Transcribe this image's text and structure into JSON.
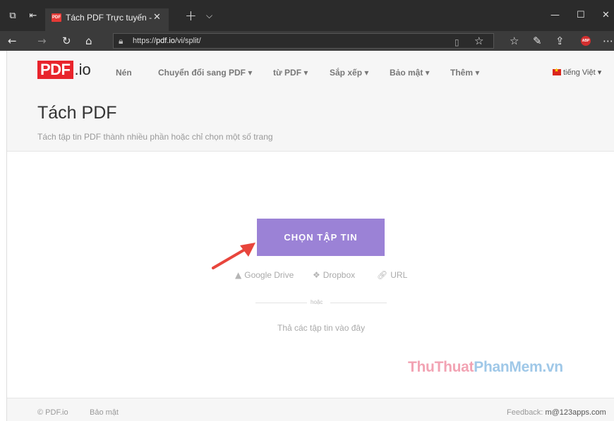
{
  "browser": {
    "tab_title": "Tách PDF Trực tuyến - Tr",
    "favicon_text": "PDF",
    "url_prefix": "https://",
    "url_host": "pdf.io",
    "url_path": "/vi/split/",
    "icons": {
      "tab_actions": "tab-actions-icon",
      "tab_back": "set-aside-tabs-icon",
      "close": "close-icon",
      "new_tab": "plus-icon",
      "tab_list": "chevron-down-icon",
      "minimize": "minimize-icon",
      "maximize": "maximize-icon",
      "window_close": "close-icon",
      "back": "back-arrow-icon",
      "forward": "forward-arrow-icon",
      "refresh": "refresh-icon",
      "home": "home-icon",
      "lock": "lock-icon",
      "reading": "reading-view-icon",
      "star": "star-icon",
      "favorites": "favorites-icon",
      "pen": "pen-icon",
      "share": "share-icon",
      "more": "more-icon"
    },
    "abp_text": "ABP"
  },
  "site": {
    "logo_pdf": "PDF",
    "logo_io": ".io",
    "nav": [
      {
        "label": "Nén"
      },
      {
        "label": "Chuyển đổi sang PDF ▾"
      },
      {
        "label": "từ PDF ▾"
      },
      {
        "label": "Sắp xếp ▾"
      },
      {
        "label": "Bảo mật ▾"
      },
      {
        "label": "Thêm ▾"
      }
    ],
    "language": "tiếng Việt ▾"
  },
  "main": {
    "title": "Tách PDF",
    "subtitle": "Tách tập tin PDF thành nhiều phần hoặc chỉ chọn một số trang",
    "choose_button": "CHỌN TẬP TIN",
    "sources": {
      "google_drive": "Google Drive",
      "dropbox": "Dropbox",
      "url": "URL"
    },
    "or": "hoặc",
    "drop_text": "Thả các tập tin vào đây"
  },
  "watermark": {
    "part1": "ThuThuat",
    "part2": "PhanMem",
    "part3": ".vn"
  },
  "footer": {
    "copyright": "© PDF.io",
    "privacy": "Bảo mật",
    "feedback_label": "Feedback:",
    "feedback_email": "m@123apps.com"
  },
  "colors": {
    "brand_red": "#e8242c",
    "button_purple": "#9b82d6",
    "arrow_red": "#e8453c"
  }
}
